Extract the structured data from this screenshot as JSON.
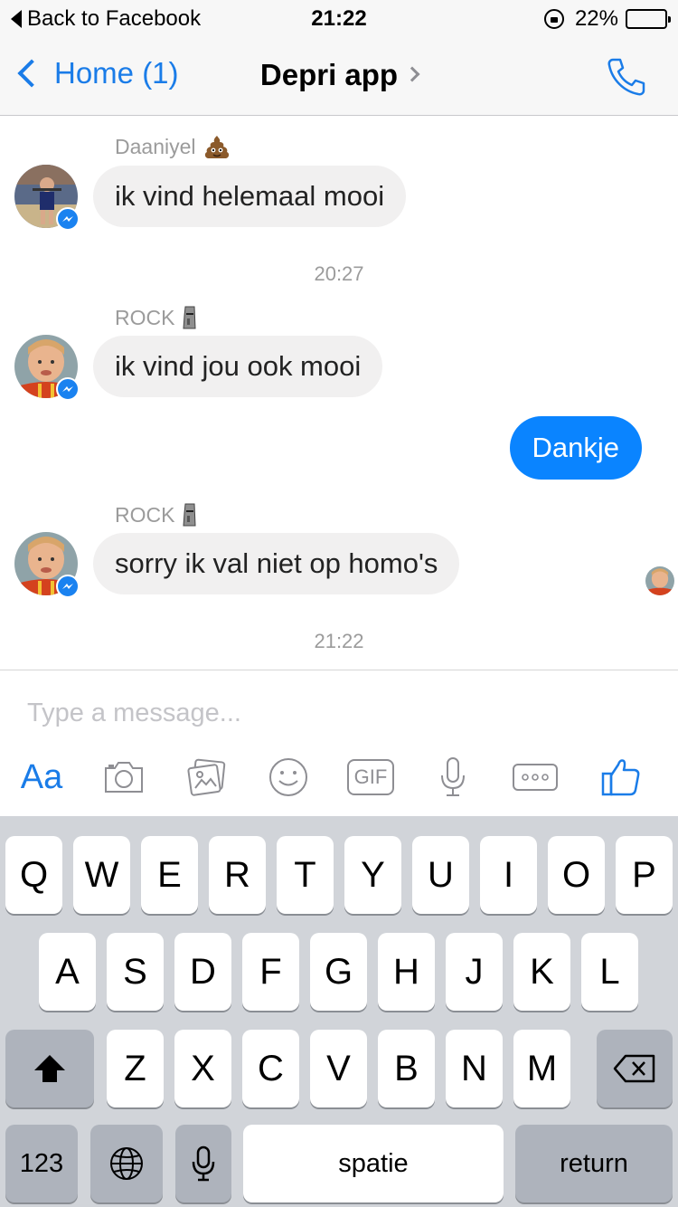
{
  "status_bar": {
    "back_label": "Back to Facebook",
    "time": "21:22",
    "battery_percent": "22%",
    "battery_level": 0.22,
    "battery_color": "#f5c400"
  },
  "nav": {
    "back_label": "Home (1)",
    "title": "Depri app",
    "accent_color": "#1a7ce8",
    "call_icon": "phone-icon"
  },
  "messages": [
    {
      "type": "incoming",
      "sender": "Daaniyel",
      "sender_emoji": "poop-emoji",
      "text": "ik vind helemaal mooi"
    },
    {
      "type": "timestamp",
      "text": "20:27"
    },
    {
      "type": "incoming",
      "sender": "ROCK",
      "sender_emoji": "moai-emoji",
      "text": "ik vind jou ook mooi"
    },
    {
      "type": "outgoing",
      "text": "Dankje"
    },
    {
      "type": "incoming",
      "sender": "ROCK",
      "sender_emoji": "moai-emoji",
      "text": "sorry ik val niet op homo's"
    },
    {
      "type": "timestamp",
      "text": "21:22"
    }
  ],
  "composer": {
    "placeholder": "Type a message...",
    "text_tool_label": "Aa",
    "gif_label": "GIF",
    "tools": [
      "text-format-icon",
      "camera-icon",
      "gallery-icon",
      "emoji-icon",
      "gif-icon",
      "microphone-icon",
      "more-icon",
      "thumbs-up-icon"
    ]
  },
  "keyboard": {
    "row1": [
      "Q",
      "W",
      "E",
      "R",
      "T",
      "Y",
      "U",
      "I",
      "O",
      "P"
    ],
    "row2": [
      "A",
      "S",
      "D",
      "F",
      "G",
      "H",
      "J",
      "K",
      "L"
    ],
    "row3": [
      "Z",
      "X",
      "C",
      "V",
      "B",
      "N",
      "M"
    ],
    "numbers_label": "123",
    "space_label": "spatie",
    "return_label": "return"
  }
}
